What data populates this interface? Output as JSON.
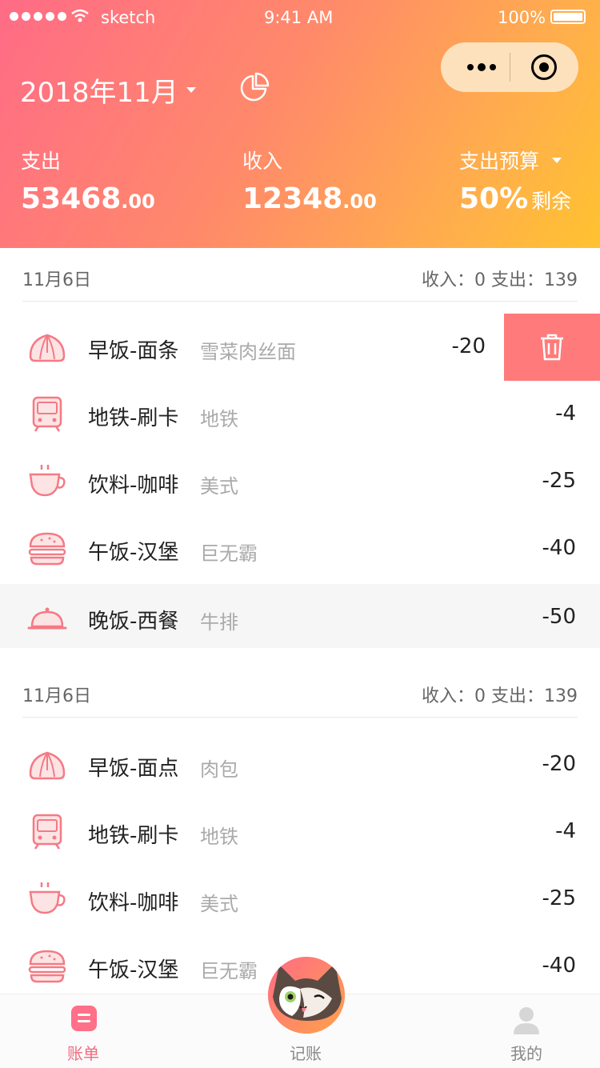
{
  "status": {
    "carrier": "sketch",
    "time": "9:41 AM",
    "battery": "100%"
  },
  "header": {
    "month": "2018年11月",
    "expense_label": "支出",
    "expense_int": "53468",
    "expense_dec": ".00",
    "income_label": "收入",
    "income_int": "12348",
    "income_dec": ".00",
    "budget_label": "支出预算",
    "budget_percent": "50%",
    "budget_remaining": "剩余"
  },
  "groups": [
    {
      "date": "11月6日",
      "summary": "收入：0   支出：139",
      "items": [
        {
          "icon": "bun-icon",
          "title": "早饭-面条",
          "sub": "雪菜肉丝面",
          "amount": "-20"
        },
        {
          "icon": "subway-icon",
          "title": "地铁-刷卡",
          "sub": "地铁",
          "amount": "-4"
        },
        {
          "icon": "coffee-icon",
          "title": "饮料-咖啡",
          "sub": "美式",
          "amount": "-25"
        },
        {
          "icon": "burger-icon",
          "title": "午饭-汉堡",
          "sub": "巨无霸",
          "amount": "-40"
        },
        {
          "icon": "dish-icon",
          "title": "晚饭-西餐",
          "sub": "牛排",
          "amount": "-50"
        }
      ]
    },
    {
      "date": "11月6日",
      "summary": "收入：0   支出：139",
      "items": [
        {
          "icon": "bun-icon",
          "title": "早饭-面点",
          "sub": "肉包",
          "amount": "-20"
        },
        {
          "icon": "subway-icon",
          "title": "地铁-刷卡",
          "sub": "地铁",
          "amount": "-4"
        },
        {
          "icon": "coffee-icon",
          "title": "饮料-咖啡",
          "sub": "美式",
          "amount": "-25"
        },
        {
          "icon": "burger-icon",
          "title": "午饭-汉堡",
          "sub": "巨无霸",
          "amount": "-40"
        }
      ]
    }
  ],
  "tabs": [
    {
      "label": "账单",
      "active": true
    },
    {
      "label": "记账",
      "active": false
    },
    {
      "label": "我的",
      "active": false
    }
  ],
  "colors": {
    "accent": "#f06b7f",
    "delete": "#ff7b7b",
    "icon": "#f47a85"
  }
}
